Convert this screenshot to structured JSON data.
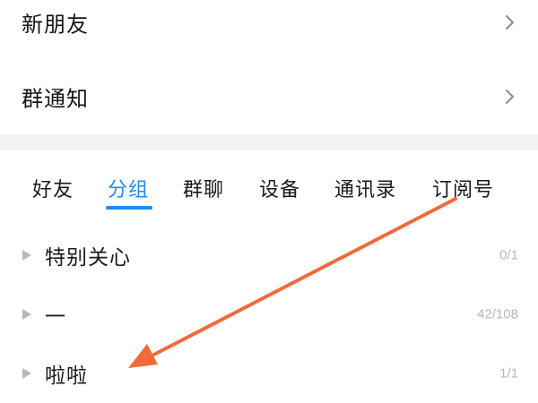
{
  "top_list": {
    "new_friends": {
      "label": "新朋友",
      "icon": "chevron-right-icon"
    },
    "group_notice": {
      "label": "群通知",
      "icon": "chevron-right-icon"
    }
  },
  "tabs": [
    {
      "label": "好友",
      "active": false
    },
    {
      "label": "分组",
      "active": true
    },
    {
      "label": "群聊",
      "active": false
    },
    {
      "label": "设备",
      "active": false
    },
    {
      "label": "通讯录",
      "active": false
    },
    {
      "label": "订阅号",
      "active": false
    }
  ],
  "groups": [
    {
      "name": "特别关心",
      "count": "0/1"
    },
    {
      "name": "一",
      "count": "42/108"
    },
    {
      "name": "啦啦",
      "count": "1/1"
    }
  ],
  "colors": {
    "accent": "#1e8df3",
    "annotation_arrow": "#f06a3c",
    "count_text": "#b7b7b7",
    "band": "#f3f3f3"
  }
}
